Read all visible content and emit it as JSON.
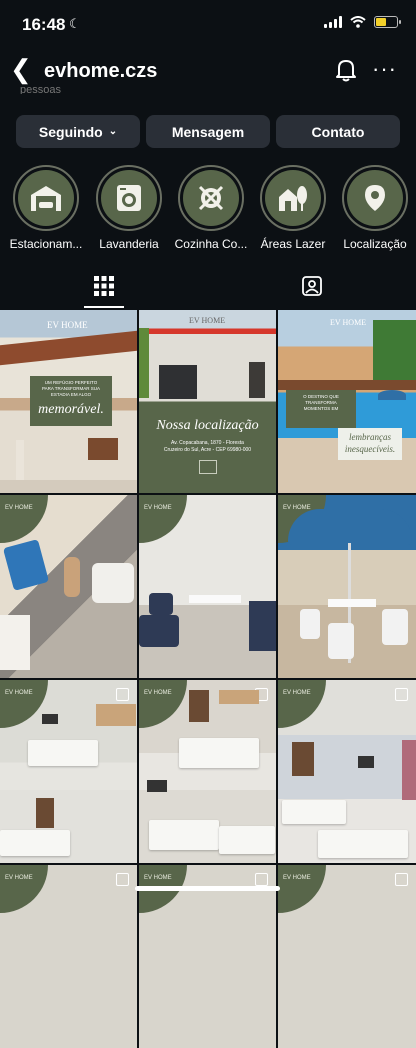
{
  "status": {
    "time": "16:48"
  },
  "header": {
    "username": "evhome.czs",
    "peek_text": "pessoas"
  },
  "actions": {
    "following": "Seguindo",
    "message": "Mensagem",
    "contact": "Contato"
  },
  "highlights": [
    {
      "label": "Estacionam...",
      "icon": "garage-icon"
    },
    {
      "label": "Lavanderia",
      "icon": "washing-machine-icon"
    },
    {
      "label": "Cozinha Co...",
      "icon": "kitchen-icon"
    },
    {
      "label": "Áreas Lazer",
      "icon": "house-tree-icon"
    },
    {
      "label": "Localização",
      "icon": "location-pin-icon"
    }
  ],
  "posts": {
    "p1": {
      "brand": "EV HOME",
      "line1": "UM REFÚGIO PERFEITO",
      "line2": "PARA TRANSFORMAR SUA",
      "line3": "ESTADIA EM ALGO",
      "big": "memorável."
    },
    "p2": {
      "brand": "EV HOME",
      "title": "Nossa localização",
      "addr1": "Av. Copacabana, 1870 - Floresta",
      "addr2": "Cruzeiro do Sul, Acre - CEP 69980-000"
    },
    "p3": {
      "brand": "EV HOME",
      "line1": "O DESTINO QUE",
      "line2": "TRANSFORMA",
      "line3": "MOMENTOS EM",
      "line4": "lembranças",
      "line5": "inesquecíveis."
    },
    "badge": "EV HOME"
  },
  "colors": {
    "background": "#0c1014",
    "button": "#2a2f37",
    "brand_green": "#58664a"
  }
}
